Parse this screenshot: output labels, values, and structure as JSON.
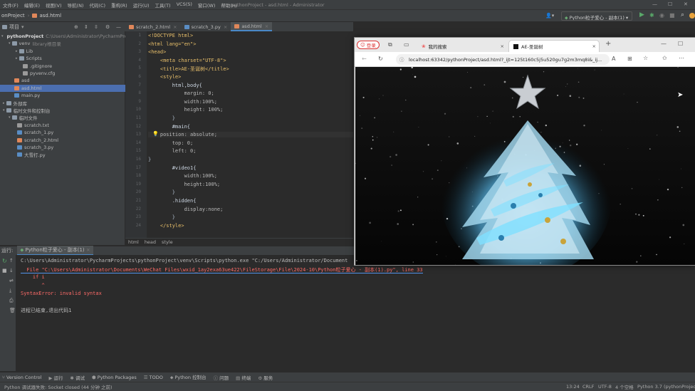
{
  "ide": {
    "menu": [
      "文件(F)",
      "编辑(E)",
      "视图(V)",
      "导航(N)",
      "代码(C)",
      "重构(R)",
      "运行(U)",
      "工具(T)",
      "VCS(S)",
      "窗口(W)",
      "帮助(H)"
    ],
    "window_title": "pythonProject - asd.html - Administrator",
    "breadcrumb": {
      "project": "onProject",
      "file": "asd.html"
    },
    "run_config": "Python粒子爱心 - 副本(1)",
    "project_header": "项目"
  },
  "project_tree": [
    {
      "label": "pythonProject",
      "extra": "C:\\Users\\Administrator\\PycharmPro",
      "type": "folder",
      "bold": true,
      "arrow": "▾"
    },
    {
      "label": "venv",
      "extra": "library根目录",
      "type": "folder",
      "arrow": "▾"
    },
    {
      "label": "Lib",
      "extra": "",
      "type": "folder",
      "arrow": "▸"
    },
    {
      "label": "Scripts",
      "extra": "",
      "type": "folder",
      "arrow": "▸"
    },
    {
      "label": ".gitignore",
      "extra": "",
      "type": "txt",
      "arrow": ""
    },
    {
      "label": "pyvenv.cfg",
      "extra": "",
      "type": "txt",
      "arrow": ""
    },
    {
      "label": "asd",
      "extra": "",
      "type": "html",
      "arrow": ""
    },
    {
      "label": "asd.html",
      "extra": "",
      "type": "html",
      "arrow": "",
      "selected": true
    },
    {
      "label": "main.py",
      "extra": "",
      "type": "py",
      "arrow": ""
    },
    {
      "label": "外部库",
      "extra": "",
      "type": "folder",
      "arrow": "▸"
    },
    {
      "label": "临时文件和控制台",
      "extra": "",
      "type": "folder",
      "arrow": "▾"
    },
    {
      "label": "临时文件",
      "extra": "",
      "type": "folder",
      "arrow": "▾"
    },
    {
      "label": "scratch.txt",
      "extra": "",
      "type": "txt",
      "arrow": ""
    },
    {
      "label": "scratch_1.py",
      "extra": "",
      "type": "py",
      "arrow": ""
    },
    {
      "label": "scratch_2.html",
      "extra": "",
      "type": "html",
      "arrow": ""
    },
    {
      "label": "scratch_3.py",
      "extra": "",
      "type": "py",
      "arrow": ""
    },
    {
      "label": "大雪打.py",
      "extra": "",
      "type": "py",
      "arrow": ""
    }
  ],
  "editor_tabs": [
    {
      "label": "scratch_2.html",
      "type": "html",
      "active": false
    },
    {
      "label": "scratch_3.py",
      "type": "py",
      "active": false
    },
    {
      "label": "asd.html",
      "type": "html",
      "active": true
    }
  ],
  "code_lines": [
    {
      "n": "1",
      "indent": "",
      "text": "<!DOCTYPE html>",
      "c": "#e8bf6a"
    },
    {
      "n": "2",
      "indent": "",
      "text": "<html lang=\"en\">",
      "c": "#e8bf6a"
    },
    {
      "n": "3",
      "indent": "",
      "text": "<head>",
      "c": "#e8bf6a"
    },
    {
      "n": "4",
      "indent": "    ",
      "text": "<meta charset=\"UTF-8\">",
      "c": "#e8bf6a"
    },
    {
      "n": "5",
      "indent": "    ",
      "text": "<title>AE-圣诞树</title>",
      "c": "#e8bf6a"
    },
    {
      "n": "6",
      "indent": "    ",
      "text": "<style>",
      "c": "#e8bf6a"
    },
    {
      "n": "7",
      "indent": "        ",
      "text": "html,body{",
      "c": "#cbd5e1"
    },
    {
      "n": "8",
      "indent": "            ",
      "text": "margin: 0;",
      "c": "#bababa"
    },
    {
      "n": "9",
      "indent": "            ",
      "text": "width:100%;",
      "c": "#bababa"
    },
    {
      "n": "10",
      "indent": "            ",
      "text": "height: 100%;",
      "c": "#bababa"
    },
    {
      "n": "11",
      "indent": "        ",
      "text": "}",
      "c": "#a9b7c6"
    },
    {
      "n": "12",
      "indent": "        ",
      "text": "#main{",
      "c": "#cbd5e1"
    },
    {
      "n": "13",
      "indent": "    ",
      "text": "position: absolute;",
      "c": "#bababa",
      "hl": true
    },
    {
      "n": "14",
      "indent": "        ",
      "text": "top: 0;",
      "c": "#bababa"
    },
    {
      "n": "15",
      "indent": "        ",
      "text": "left: 0;",
      "c": "#bababa"
    },
    {
      "n": "16",
      "indent": "",
      "text": "}",
      "c": "#a9b7c6"
    },
    {
      "n": "17",
      "indent": "        ",
      "text": "#video1{",
      "c": "#cbd5e1"
    },
    {
      "n": "18",
      "indent": "            ",
      "text": "width:100%;",
      "c": "#bababa"
    },
    {
      "n": "19",
      "indent": "            ",
      "text": "height:100%;",
      "c": "#bababa"
    },
    {
      "n": "20",
      "indent": "        ",
      "text": "}",
      "c": "#a9b7c6"
    },
    {
      "n": "21",
      "indent": "        ",
      "text": ".hidden{",
      "c": "#cbd5e1"
    },
    {
      "n": "22",
      "indent": "            ",
      "text": "display:none;",
      "c": "#bababa"
    },
    {
      "n": "23",
      "indent": "        ",
      "text": "}",
      "c": "#a9b7c6"
    },
    {
      "n": "24",
      "indent": "    ",
      "text": "</style>",
      "c": "#e8bf6a"
    }
  ],
  "editor_crumbs": [
    "html",
    "head",
    "style"
  ],
  "run": {
    "label": "运行:",
    "config": "Python粒子爱心 - 副本(1)",
    "lines": [
      {
        "text": "C:\\Users\\Administrator\\PycharmProjects\\pythonProject\\venv\\Scripts\\python.exe \"C:/Users/Administrator/Document",
        "c": "#bbbbbb"
      },
      {
        "text": "  File \"C:\\Users\\Administrator\\Documents\\WeChat Files\\wxid_1ay2exa63ue422\\FileStorage\\File\\2024-10\\Python粒子爱心 - 副本(1).py\", line 33",
        "c": "#ff6b68",
        "link": true
      },
      {
        "text": "    if i",
        "c": "#ff6b68"
      },
      {
        "text": "       ^",
        "c": "#ff6b68"
      },
      {
        "text": "SyntaxError: invalid syntax",
        "c": "#ff6b68"
      },
      {
        "text": "",
        "c": "#bbbbbb"
      },
      {
        "text": "进程已结束,退出代码1",
        "c": "#bbbbbb"
      }
    ]
  },
  "bottom_tabs": [
    "Version Control",
    "运行",
    "调试",
    "Python Packages",
    "TODO",
    "Python 控制台",
    "问题",
    "终端",
    "服务"
  ],
  "status": {
    "message": "Python 调试器失败: Socket closed (44 分钟 之前)",
    "position": "13:24",
    "line_sep": "CRLF",
    "encoding": "UTF-8",
    "indent": "4 个空格",
    "interpreter": "Python 3.7 (pythonProject)"
  },
  "browser": {
    "login": "登录",
    "tabs": [
      {
        "label": "我的搜索",
        "active": false
      },
      {
        "label": "AE-圣诞树",
        "active": true
      }
    ],
    "url": "localhost:63342/pythonProject/asd.html?_ijt=125t160c5j5u520gu7g2m3mq8i&_ij..."
  }
}
